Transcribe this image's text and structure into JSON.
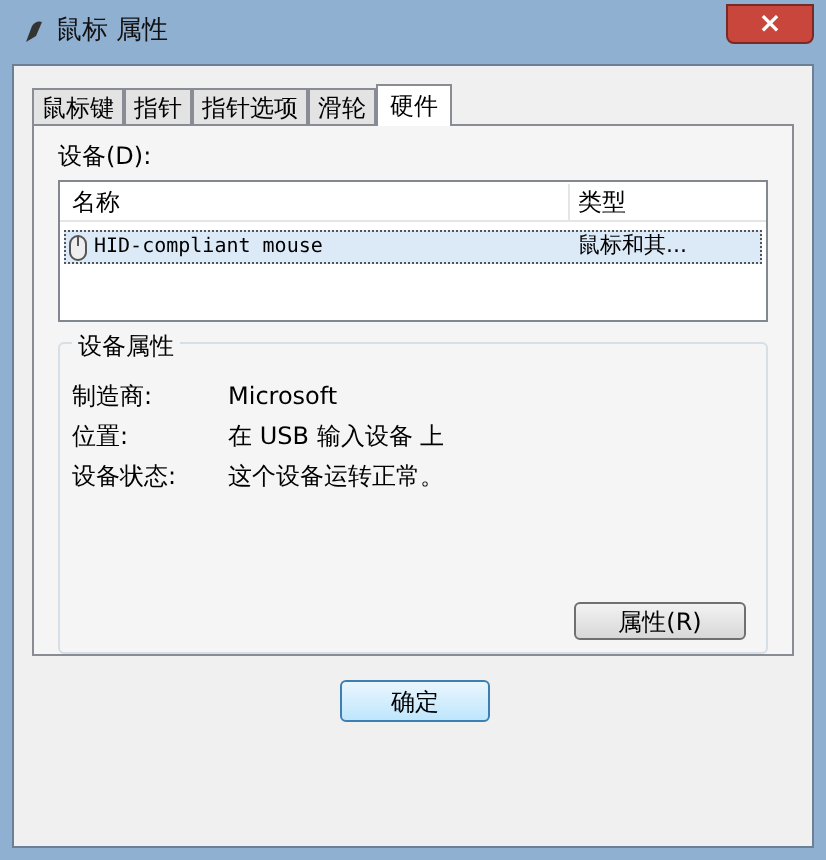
{
  "window": {
    "title": "鼠标 属性",
    "close": "×"
  },
  "tabs": [
    {
      "label": "鼠标键",
      "selected": false
    },
    {
      "label": "指针",
      "selected": false
    },
    {
      "label": "指针选项",
      "selected": false
    },
    {
      "label": "滑轮",
      "selected": false
    },
    {
      "label": "硬件",
      "selected": true
    }
  ],
  "devices": {
    "label": "设备(D):",
    "columns": [
      "名称",
      "类型"
    ],
    "rows": [
      {
        "name": "HID-compliant mouse",
        "type": "鼠标和其...",
        "selected": true
      }
    ]
  },
  "device_properties": {
    "title": "设备属性",
    "fields": [
      {
        "label": "制造商:",
        "value": "Microsoft"
      },
      {
        "label": "位置:",
        "value": "在 USB 输入设备 上"
      },
      {
        "label": "设备状态:",
        "value": "这个设备运转正常。"
      }
    ],
    "button": "属性(R)"
  },
  "buttons": [
    "确定"
  ]
}
